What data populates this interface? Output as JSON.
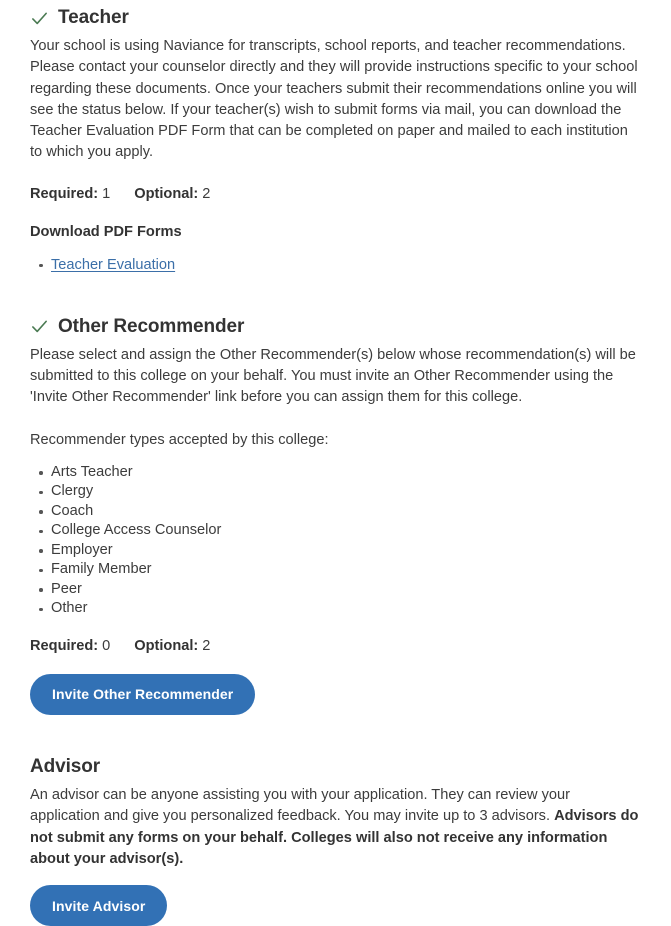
{
  "sections": [
    {
      "id": "teacher",
      "title": "Teacher",
      "has_check_icon": true,
      "check_icon": "check-icon",
      "description": "Your school is using Naviance for transcripts, school reports, and teacher recommendations. Please contact your counselor directly and they will provide instructions specific to your school regarding these documents. Once your teachers submit their recommendations online you will see the status below. If your teacher(s) wish to submit forms via mail, you can download the Teacher Evaluation PDF Form that can be completed on paper and mailed to each institution to which you apply.",
      "counts": {
        "required_label": "Required:",
        "required_value": "1",
        "optional_label": "Optional:",
        "optional_value": "2"
      },
      "downloads_heading": "Download PDF Forms",
      "download_links": [
        "Teacher Evaluation"
      ]
    },
    {
      "id": "other-recommender",
      "title": "Other Recommender",
      "has_check_icon": true,
      "check_icon": "check-icon",
      "description": "Please select and assign the Other Recommender(s) below whose recommendation(s) will be submitted to this college on your behalf. You must invite an Other Recommender using the 'Invite Other Recommender' link before you can assign them for this college.",
      "types_heading": "Recommender types accepted by this college:",
      "types": [
        "Arts Teacher",
        "Clergy",
        "Coach",
        "College Access Counselor",
        "Employer",
        "Family Member",
        "Peer",
        "Other"
      ],
      "counts": {
        "required_label": "Required:",
        "required_value": "0",
        "optional_label": "Optional:",
        "optional_value": "2"
      },
      "button_label": "Invite Other Recommender"
    },
    {
      "id": "advisor",
      "title": "Advisor",
      "has_check_icon": false,
      "description_plain": "An advisor can be anyone assisting you with your application. They can review your application and give you personalized feedback. You may invite up to 3 advisors. ",
      "description_bold": "Advisors do not submit any forms on your behalf. Colleges will also not receive any information about your advisor(s).",
      "button_label": "Invite Advisor"
    }
  ],
  "colors": {
    "button_blue": "#3271b5",
    "link_blue": "#3b6fa8",
    "check_green": "#4a7a52",
    "heading_text": "#333333",
    "body_text": "#3c3c3c",
    "background": "#ffffff"
  }
}
